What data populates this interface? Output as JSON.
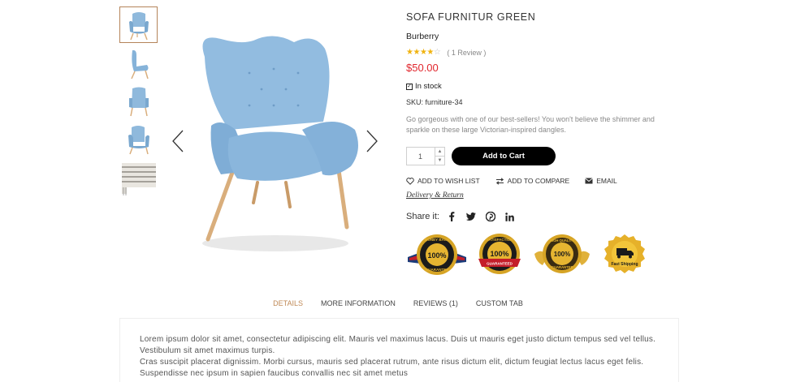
{
  "thumbnails": [
    {
      "name": "chair-front",
      "active": true
    },
    {
      "name": "chair-side",
      "active": false
    },
    {
      "name": "chair-back",
      "active": false
    },
    {
      "name": "chair-angle",
      "active": false
    },
    {
      "name": "striped-fabric",
      "active": false
    }
  ],
  "product": {
    "title": "SOFA FURNITUR GREEN",
    "brand": "Burberry",
    "rating": 4,
    "rating_max": 5,
    "reviews_text": "( 1  Review )",
    "price": "$50.00",
    "stock": "In stock",
    "sku": "SKU: furniture-34",
    "description": "Go gorgeous with one of our best-sellers! You won't believe the shimmer and sparkle on these large Victorian-inspired dangles.",
    "quantity": "1",
    "add_to_cart": "Add to Cart"
  },
  "actions": {
    "wishlist": "ADD TO WISH LIST",
    "compare": "ADD TO COMPARE",
    "email": "EMAIL"
  },
  "delivery_link": "Delivery & Return",
  "share": {
    "label": "Share it:",
    "networks": [
      "facebook-icon",
      "twitter-icon",
      "pinterest-icon",
      "linkedin-icon"
    ]
  },
  "badges": {
    "money_back": {
      "top": "MONEY BACK",
      "center": "100%",
      "bottom": "GUARANTEE"
    },
    "satisfaction": {
      "top": "SATISFACTION",
      "center": "100%",
      "bottom": "GUARANTEED"
    },
    "quality": {
      "top": "HIGH QUALITY",
      "center": "100%",
      "bottom": "GUARANTEE"
    },
    "shipping": {
      "bottom": "Fast Shipping"
    }
  },
  "tabs": [
    {
      "label": "DETAILS",
      "active": true
    },
    {
      "label": "MORE INFORMATION",
      "active": false
    },
    {
      "label": "REVIEWS (1)",
      "active": false
    },
    {
      "label": "CUSTOM TAB",
      "active": false
    }
  ],
  "details": {
    "line1": "Lorem ipsum dolor sit amet, consectetur adipiscing elit. Mauris vel maximus lacus. Duis ut mauris eget justo dictum tempus sed vel tellus. Vestibulum sit amet maximus turpis.",
    "line2": "Cras suscipit placerat dignissim. Morbi cursus, mauris sed placerat rutrum, ante risus dictum elit, dictum feugiat lectus lacus eget felis. Suspendisse nec ipsum in sapien faucibus convallis nec sit amet metus"
  },
  "colors": {
    "price": "#e1262d",
    "accent": "#c08a57",
    "chair": "#8fb9dc",
    "wood": "#d9ae7c"
  }
}
